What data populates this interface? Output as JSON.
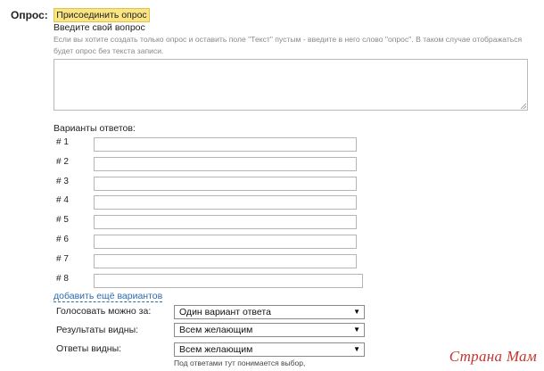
{
  "poll": {
    "label": "Опрос:",
    "attach_button": "Присоединить опрос",
    "question_title": "Введите свой вопрос",
    "hint": "Если вы хотите создать только опрос и оставить поле \"Текст\" пустым - введите в него слово \"опрос\". В таком случае отображаться будет опрос без текста записи.",
    "question_value": ""
  },
  "options": {
    "title": "Варианты ответов:",
    "items": [
      {
        "label": "# 1",
        "value": ""
      },
      {
        "label": "# 2",
        "value": ""
      },
      {
        "label": "# 3",
        "value": ""
      },
      {
        "label": "# 4",
        "value": ""
      },
      {
        "label": "# 5",
        "value": ""
      },
      {
        "label": "# 6",
        "value": ""
      },
      {
        "label": "# 7",
        "value": ""
      },
      {
        "label": "# 8",
        "value": ""
      }
    ],
    "add_more": "добавить ещё вариантов"
  },
  "settings": {
    "vote_label": "Голосовать можно за:",
    "vote_value": "Один вариант ответа",
    "results_label": "Результаты видны:",
    "results_value": "Всем желающим",
    "answers_label": "Ответы видны:",
    "answers_value": "Всем желающим",
    "note": "Под ответами тут понимается выбор,"
  },
  "watermark": "Страна Мам",
  "icons": {
    "dropdown_arrow": "▼"
  }
}
